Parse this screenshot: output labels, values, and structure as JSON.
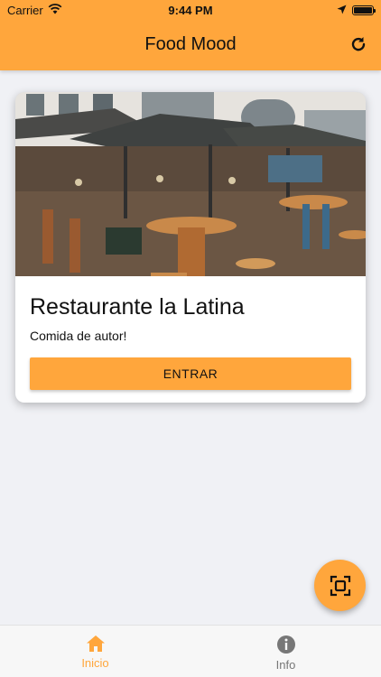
{
  "status_bar": {
    "carrier": "Carrier",
    "time": "9:44 PM",
    "battery_level": 1.0
  },
  "header": {
    "title": "Food Mood",
    "refresh_icon": "refresh-icon"
  },
  "card": {
    "image": "restaurant-terrace-photo",
    "title": "Restaurante la Latina",
    "subtitle": "Comida de autor!",
    "button_label": "ENTRAR"
  },
  "fab": {
    "icon": "scan-icon"
  },
  "tabs": [
    {
      "label": "Inicio",
      "icon": "home-icon",
      "active": true
    },
    {
      "label": "Info",
      "icon": "info-icon",
      "active": false
    }
  ],
  "colors": {
    "accent": "#ffa63c",
    "background": "#f0f1f5",
    "inactive_tab": "#777777"
  }
}
